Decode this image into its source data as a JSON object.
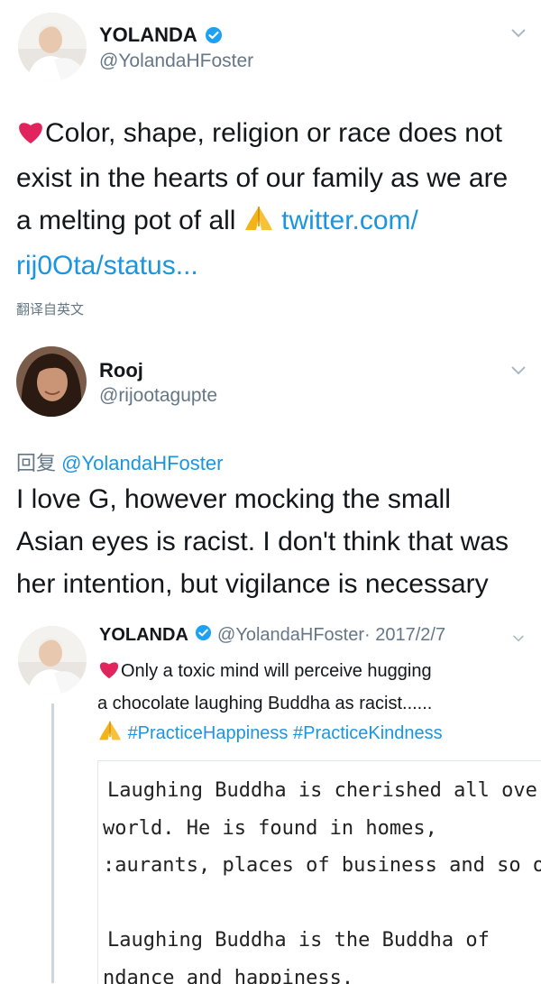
{
  "tweet1": {
    "name": "YOLANDA",
    "handle": "@YolandaHFoster",
    "text_line1": "Color, shape, religion or race does not",
    "text_line2": "exist in the hearts of our family as we are",
    "text_line3": "a melting pot of all",
    "link_part1": "twitter.com/",
    "link_part2": "rij0Ota/status...",
    "translate_label": "翻译自英文"
  },
  "reply": {
    "name": "Rooj",
    "handle": "@rijootagupte",
    "reply_prefix": "回复",
    "reply_to": "@YolandaHFoster",
    "text_line1": "I love G, however mocking the small",
    "text_line2": "Asian eyes is racist. I don't think that was",
    "text_line3": "her intention, but vigilance is necessary"
  },
  "quoted": {
    "name": "YOLANDA",
    "handle": "@YolandaHFoster",
    "date": "· 2017/2/7",
    "text_line1": "Only a toxic mind will perceive hugging",
    "text_line2": "a chocolate laughing Buddha as racist......",
    "hashtags": "#PracticeHappiness #PracticeKindness",
    "image_lines": [
      "Laughing Buddha is cherished all ove",
      "world. He is found in homes,",
      ":aurants, places of business and so on",
      "",
      "Laughing Buddha is the Buddha of",
      "ndance and happiness."
    ]
  },
  "colors": {
    "link": "#1b95e0",
    "verified": "#1da1f2",
    "heart": "#e0245e"
  },
  "icons": [
    "verified-badge-icon",
    "chevron-down-icon",
    "heart-emoji-icon",
    "folded-hands-emoji-icon"
  ]
}
